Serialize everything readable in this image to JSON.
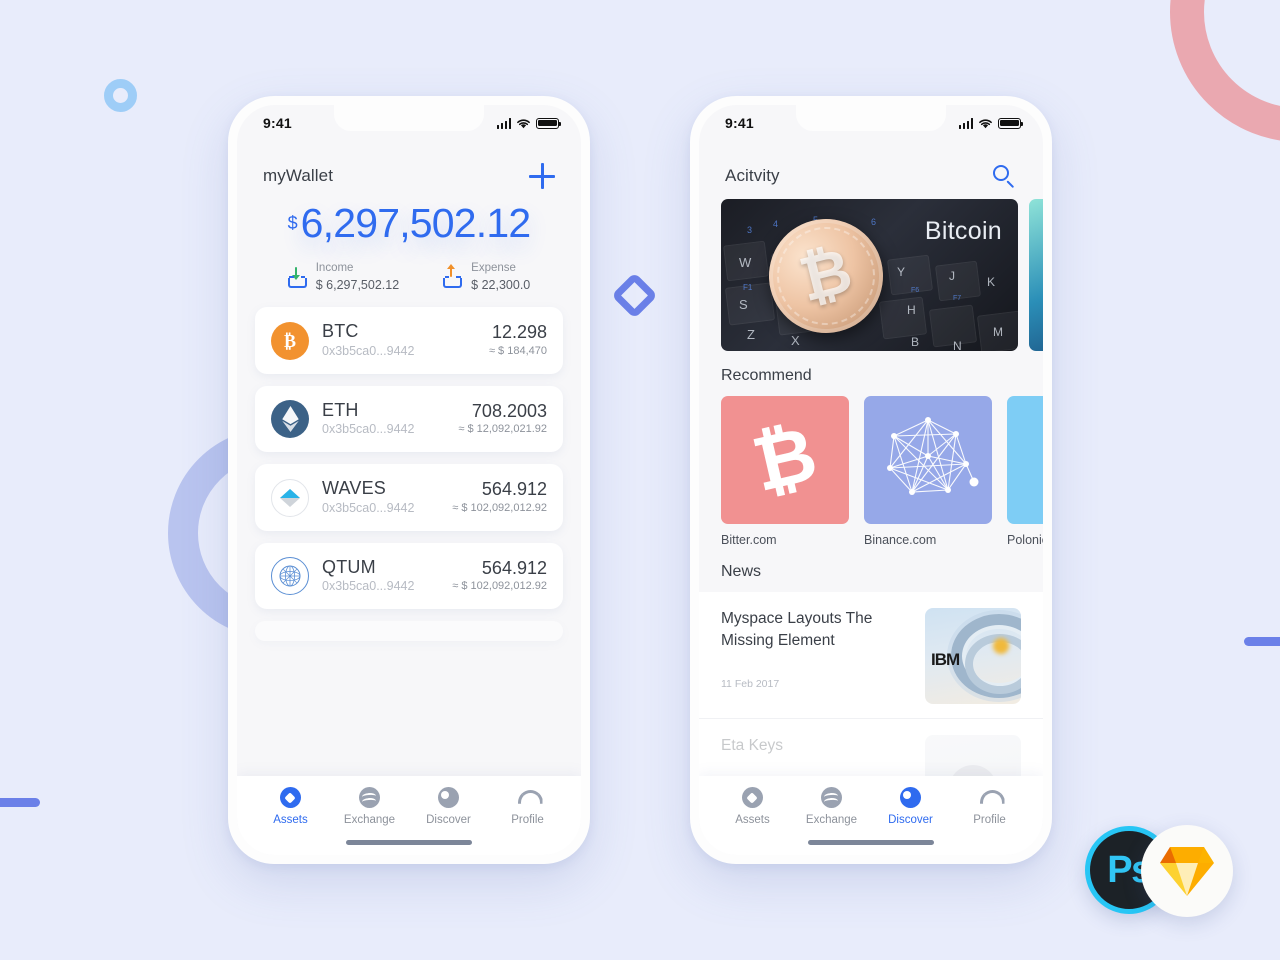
{
  "background": {
    "page_color": "#e8ecfb",
    "shapes": [
      {
        "name": "pink-ring",
        "color": "#eaa8b0"
      },
      {
        "name": "periwinkle-ring",
        "color": "#b9c4ef"
      },
      {
        "name": "blue-donut",
        "color": "#9ecdf7"
      },
      {
        "name": "diamond-outline",
        "color": "#6b80e8"
      },
      {
        "name": "left-bar",
        "color": "#6b80e8"
      },
      {
        "name": "right-bar",
        "color": "#6b80e8"
      }
    ]
  },
  "accent": {
    "primary": "#2f6bef",
    "income": "#34b36b",
    "expense": "#f0902a",
    "muted": "#8d929b"
  },
  "wallet_screen": {
    "status": {
      "time": "9:41",
      "signal": "signal-bars",
      "wifi": "wifi-icon",
      "battery": "battery-icon"
    },
    "header": {
      "title": "myWallet",
      "add_icon": "plus-icon"
    },
    "balance": {
      "currency": "$",
      "amount": "6,297,502.12"
    },
    "flows": [
      {
        "icon": "income-tray-icon",
        "label": "Income",
        "value": "$ 6,297,502.12"
      },
      {
        "icon": "expense-tray-icon",
        "label": "Expense",
        "value": "$ 22,300.0"
      }
    ],
    "assets": [
      {
        "symbol": "BTC",
        "icon": "bitcoin-coin-icon",
        "address": "0x3b5ca0...9442",
        "amount": "12.298",
        "usd": "≈ $ 184,470"
      },
      {
        "symbol": "ETH",
        "icon": "ethereum-coin-icon",
        "address": "0x3b5ca0...9442",
        "amount": "708.2003",
        "usd": "≈ $ 12,092,021.92"
      },
      {
        "symbol": "WAVES",
        "icon": "waves-coin-icon",
        "address": "0x3b5ca0...9442",
        "amount": "564.912",
        "usd": "≈ $ 102,092,012.92"
      },
      {
        "symbol": "QTUM",
        "icon": "qtum-coin-icon",
        "address": "0x3b5ca0...9442",
        "amount": "564.912",
        "usd": "≈ $ 102,092,012.92"
      }
    ],
    "tabs": [
      {
        "label": "Assets",
        "icon": "assets-icon",
        "active": true
      },
      {
        "label": "Exchange",
        "icon": "exchange-icon",
        "active": false
      },
      {
        "label": "Discover",
        "icon": "discover-icon",
        "active": false
      },
      {
        "label": "Profile",
        "icon": "profile-icon",
        "active": false
      }
    ]
  },
  "discover_screen": {
    "status": {
      "time": "9:41",
      "signal": "signal-bars",
      "wifi": "wifi-icon",
      "battery": "battery-icon"
    },
    "header": {
      "title": "Acitvity",
      "search_icon": "search-icon"
    },
    "banners": [
      {
        "title": "Bitcoin",
        "image": "bitcoin-coin-on-keyboard"
      },
      {
        "title": "",
        "image": "teal-abstract"
      }
    ],
    "recommend": {
      "section_title": "Recommend",
      "items": [
        {
          "label": "Bitter.com",
          "icon": "bitcoin-b-icon",
          "color": "#f19191"
        },
        {
          "label": "Binance.com",
          "icon": "network-mesh-icon",
          "color": "#96a8e8"
        },
        {
          "label": "Polonie",
          "icon": "",
          "color": "#7ecdf5"
        }
      ]
    },
    "news": {
      "section_title": "News",
      "items": [
        {
          "headline": "Myspace Layouts The Missing Element",
          "date": "11 Feb 2017",
          "thumb": "ibm-server-photo"
        },
        {
          "headline": "Eta Keys",
          "date": "",
          "thumb": "portrait-photo"
        }
      ]
    },
    "tabs": [
      {
        "label": "Assets",
        "icon": "assets-icon",
        "active": false
      },
      {
        "label": "Exchange",
        "icon": "exchange-icon",
        "active": false
      },
      {
        "label": "Discover",
        "icon": "discover-icon",
        "active": true
      },
      {
        "label": "Profile",
        "icon": "profile-icon",
        "active": false
      }
    ]
  },
  "badges": [
    {
      "name": "photoshop-badge",
      "label": "Ps"
    },
    {
      "name": "sketch-badge",
      "label": ""
    }
  ]
}
